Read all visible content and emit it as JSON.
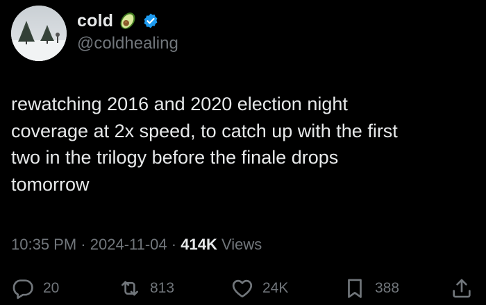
{
  "tweet": {
    "author": {
      "display_name": "cold",
      "name_emoji": "avocado-emoji",
      "verified_badge": "verified-badge-icon",
      "handle": "@coldhealing",
      "avatar": "winter-trees-avatar"
    },
    "text": "rewatching 2016 and 2020 election night\ncoverage at 2x speed, to catch up with the first\ntwo in the trilogy before the finale drops\ntomorrow",
    "time": "10:35 PM",
    "separator": "·",
    "date": "2024-11-04",
    "views_count": "414K",
    "views_label": "Views"
  },
  "actions": {
    "reply": {
      "icon": "reply-icon",
      "count": "20"
    },
    "repost": {
      "icon": "repost-icon",
      "count": "813"
    },
    "like": {
      "icon": "heart-icon",
      "count": "24K"
    },
    "bookmark": {
      "icon": "bookmark-icon",
      "count": "388"
    },
    "share": {
      "icon": "share-icon"
    }
  },
  "colors": {
    "background": "#000000",
    "text_primary": "#e7e9ea",
    "text_secondary": "#71767b",
    "verified_blue": "#1d9bf0"
  }
}
